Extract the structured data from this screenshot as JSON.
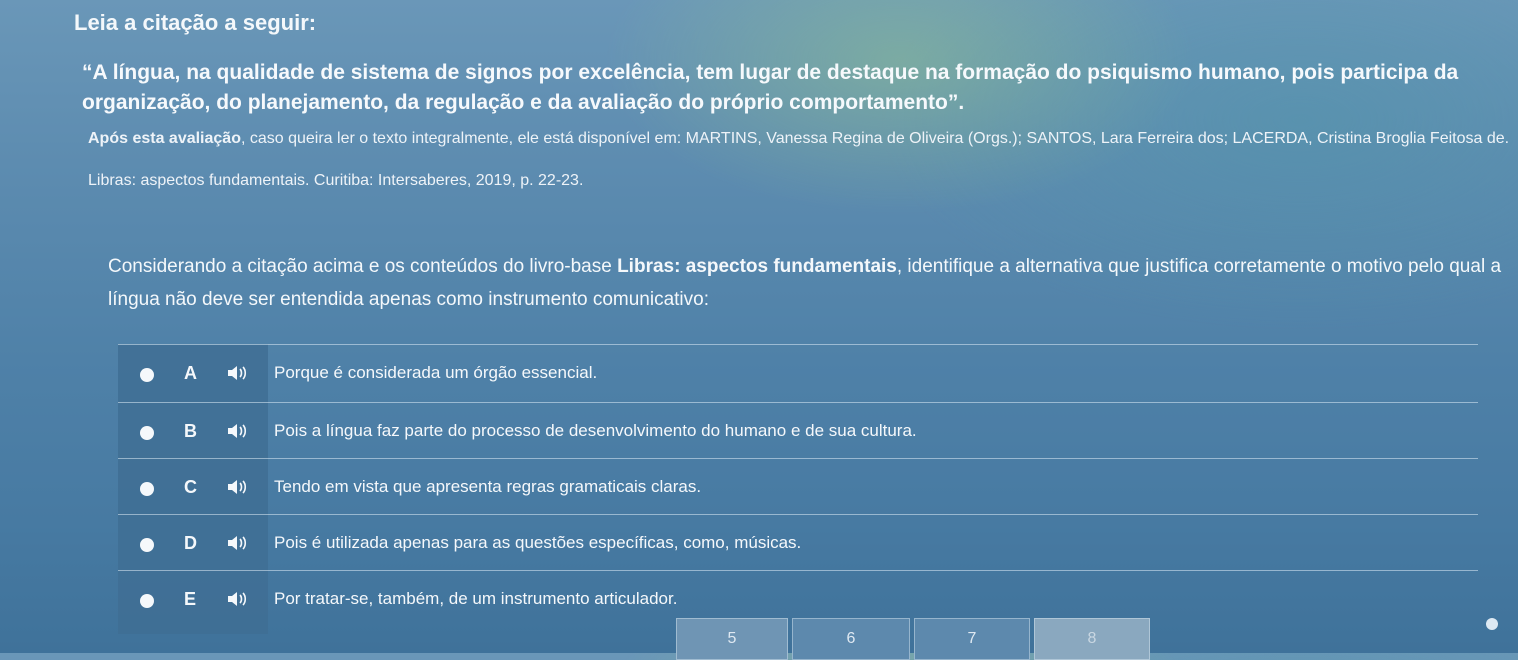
{
  "prompt_label": "Leia a citação a seguir:",
  "quote": "“A língua, na qualidade de sistema de signos por excelência, tem lugar de destaque na formação do psiquismo humano, pois participa da organização, do planejamento, da regulação e da avaliação do próprio comportamento”.",
  "reference": {
    "lead": "Após esta avaliação",
    "rest": ", caso queira ler o texto integralmente, ele está disponível em: MARTINS, Vanessa Regina de Oliveira (Orgs.); SANTOS, Lara Ferreira dos; LACERDA, Cristina Broglia Feitosa de. Libras: aspectos fundamentais. Curitiba: Intersaberes, 2019, p. 22-23."
  },
  "question": {
    "before": "Considerando a citação acima e os conteúdos do livro-base ",
    "book": "Libras: aspectos fundamentais",
    "after": ", identifique a alternativa que justifica corretamente o motivo pelo qual a língua não deve ser entendida apenas como instrumento comunicativo:"
  },
  "options": [
    {
      "letter": "A",
      "text": "Porque é considerada um órgão essencial.",
      "icon": "speaker-icon"
    },
    {
      "letter": "B",
      "text": "Pois a língua faz parte do processo de desenvolvimento do humano e de sua cultura.",
      "icon": "speaker-icon"
    },
    {
      "letter": "C",
      "text": "Tendo em vista que apresenta regras gramaticais claras.",
      "icon": "speaker-icon"
    },
    {
      "letter": "D",
      "text": "Pois é utilizada apenas para as questões específicas, como, músicas.",
      "icon": "speaker-icon"
    },
    {
      "letter": "E",
      "text": "Por tratar-se, também, de um instrumento articulador.",
      "icon": "speaker-icon"
    }
  ],
  "pagination": [
    "5",
    "6",
    "7",
    "8"
  ],
  "colors": {
    "background": "#4f81a8",
    "text": "#f5f8fb",
    "strip": "#3f6f94"
  }
}
